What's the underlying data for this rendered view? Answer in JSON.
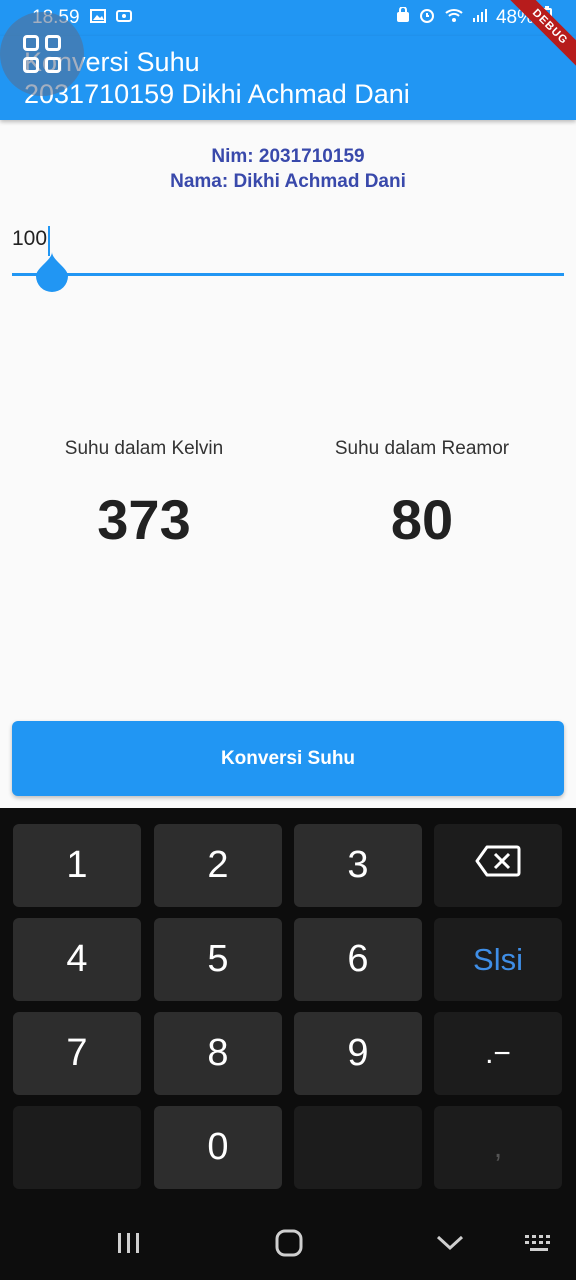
{
  "status_bar": {
    "time": "18.59",
    "battery": "48%",
    "icons": [
      "image-icon",
      "video-icon",
      "lock-icon",
      "alarm-icon",
      "wifi-icon",
      "signal-icon",
      "battery-icon"
    ]
  },
  "app_bar": {
    "title_line1": "Konversi Suhu",
    "title_line2": "2031710159 Dikhi Achmad Dani",
    "debug_banner": "DEBUG",
    "background_color": "#2196f3"
  },
  "info": {
    "nim": "Nim: 2031710159",
    "nama": "Nama: Dikhi Achmad Dani",
    "color": "#3949ab"
  },
  "input": {
    "value": "100"
  },
  "results": {
    "kelvin_label": "Suhu dalam Kelvin",
    "kelvin_value": "373",
    "reamor_label": "Suhu dalam Reamor",
    "reamor_value": "80"
  },
  "button": {
    "label": "Konversi Suhu"
  },
  "keyboard": {
    "keys": [
      "1",
      "2",
      "3",
      "4",
      "5",
      "6",
      "Slsi",
      "7",
      "8",
      "9",
      ".−",
      "0",
      ","
    ],
    "backspace_icon": "backspace-icon"
  },
  "nav_bar": {
    "icons": [
      "recent-apps-icon",
      "home-icon",
      "back-icon",
      "keyboard-icon"
    ]
  }
}
